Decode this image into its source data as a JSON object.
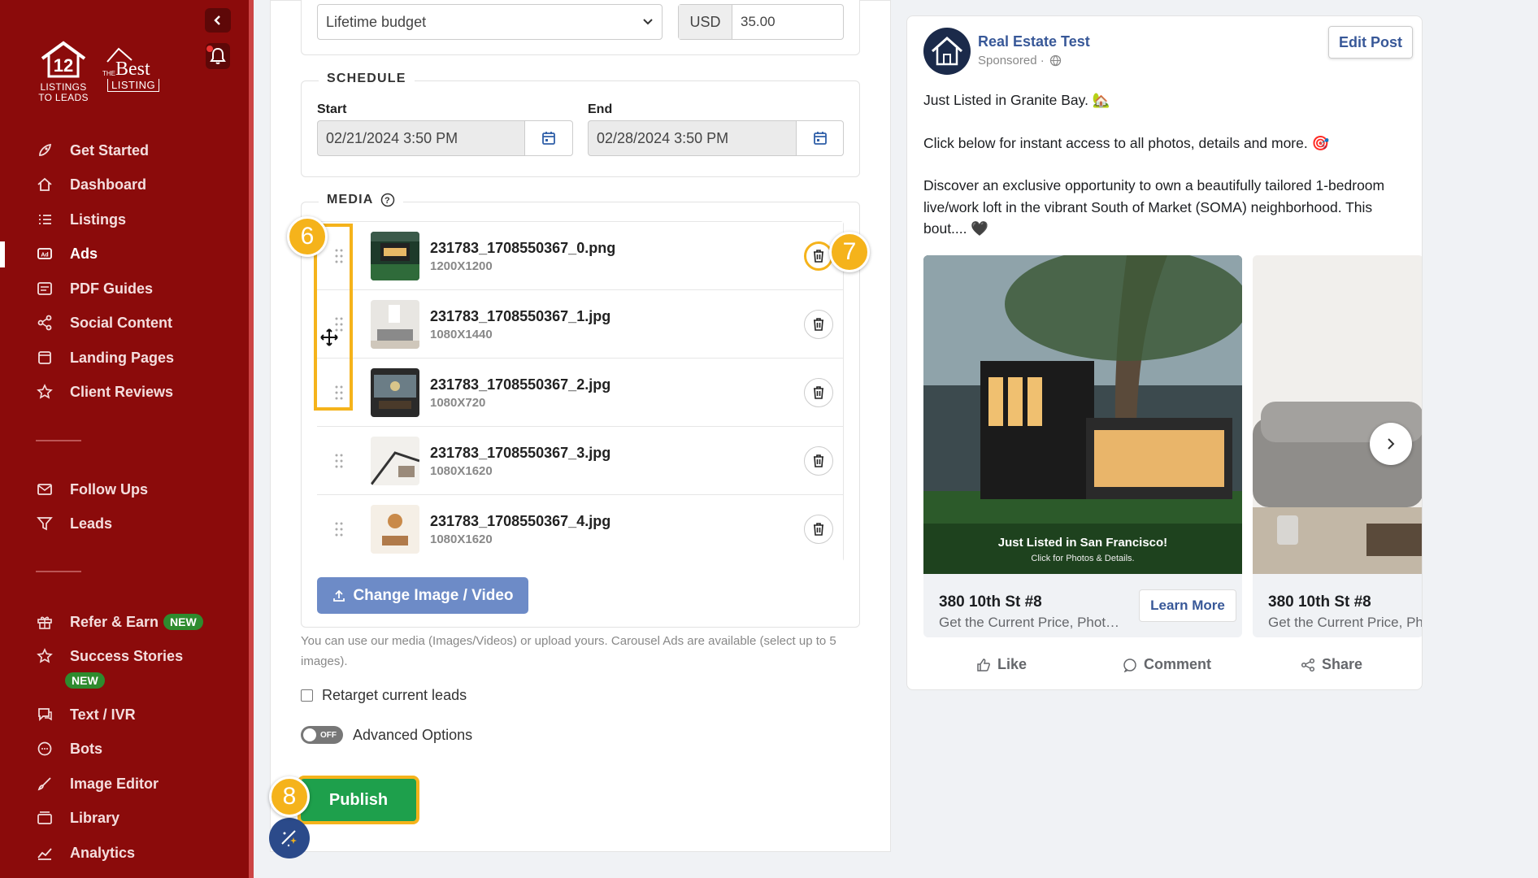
{
  "sidebar": {
    "logo1_caption": "LISTINGS\nTO LEADS",
    "logo1_number": "12",
    "logo2_the": "THE",
    "logo2_best": "Best",
    "logo2_listing": "LISTING",
    "items": [
      {
        "label": "Get Started",
        "icon": "rocket-icon"
      },
      {
        "label": "Dashboard",
        "icon": "home-icon"
      },
      {
        "label": "Listings",
        "icon": "list-icon"
      },
      {
        "label": "Ads",
        "icon": "ad-icon",
        "active": true
      },
      {
        "label": "PDF Guides",
        "icon": "pdf-icon"
      },
      {
        "label": "Social Content",
        "icon": "share-icon"
      },
      {
        "label": "Landing Pages",
        "icon": "page-icon"
      },
      {
        "label": "Client Reviews",
        "icon": "star-icon"
      },
      {
        "label": "Follow Ups",
        "icon": "mail-icon"
      },
      {
        "label": "Leads",
        "icon": "filter-icon"
      },
      {
        "label": "Refer & Earn",
        "icon": "gift-icon",
        "badge": "NEW"
      },
      {
        "label": "Success Stories",
        "icon": "star-icon",
        "badge": "NEW"
      },
      {
        "label": "Text / IVR",
        "icon": "chat-icon"
      },
      {
        "label": "Bots",
        "icon": "bot-icon"
      },
      {
        "label": "Image Editor",
        "icon": "brush-icon"
      },
      {
        "label": "Library",
        "icon": "library-icon"
      },
      {
        "label": "Analytics",
        "icon": "chart-icon"
      }
    ]
  },
  "budget": {
    "type": "Lifetime budget",
    "currency": "USD",
    "amount": "35.00"
  },
  "schedule": {
    "legend": "SCHEDULE",
    "start_label": "Start",
    "start_value": "02/21/2024 3:50 PM",
    "end_label": "End",
    "end_value": "02/28/2024 3:50 PM"
  },
  "media": {
    "legend": "MEDIA",
    "items": [
      {
        "name": "231783_1708550367_0.png",
        "size": "1200X1200"
      },
      {
        "name": "231783_1708550367_1.jpg",
        "size": "1080X1440"
      },
      {
        "name": "231783_1708550367_2.jpg",
        "size": "1080X720"
      },
      {
        "name": "231783_1708550367_3.jpg",
        "size": "1080X1620"
      },
      {
        "name": "231783_1708550367_4.jpg",
        "size": "1080X1620"
      }
    ],
    "change_button": "Change Image / Video",
    "help": "You can use our media (Images/Videos) or upload yours. Carousel Ads are available (select up to 5 images)."
  },
  "options": {
    "retarget_label": "Retarget current leads",
    "toggle_text": "OFF",
    "advanced_label": "Advanced Options"
  },
  "publish_label": "Publish",
  "steps": {
    "six": "6",
    "seven": "7",
    "eight": "8"
  },
  "preview": {
    "page_name": "Real Estate Test",
    "sponsored": "Sponsored ·",
    "edit_button": "Edit Post",
    "line1": "Just Listed in Granite Bay. 🏡",
    "line2": "Click below for instant access to all photos, details and more. 🎯",
    "line3": "Discover an exclusive opportunity to own a beautifully tailored 1-bedroom live/work loft in the vibrant South of Market (SOMA) neighborhood. This bout.... 🖤",
    "cards": [
      {
        "overlay_title": "Just Listed in San Francisco!",
        "overlay_sub": "Click for Photos & Details.",
        "title": "380 10th St #8",
        "subtitle": "Get the Current Price, Phot…",
        "cta": "Learn More"
      },
      {
        "title": "380 10th St #8",
        "subtitle": "Get the Current Price, Ph"
      }
    ],
    "actions": {
      "like": "Like",
      "comment": "Comment",
      "share": "Share"
    }
  },
  "colors": {
    "sidebar": "#8b0b0b",
    "accent": "#f5b31b",
    "publish": "#1ea04c",
    "link": "#385898"
  }
}
